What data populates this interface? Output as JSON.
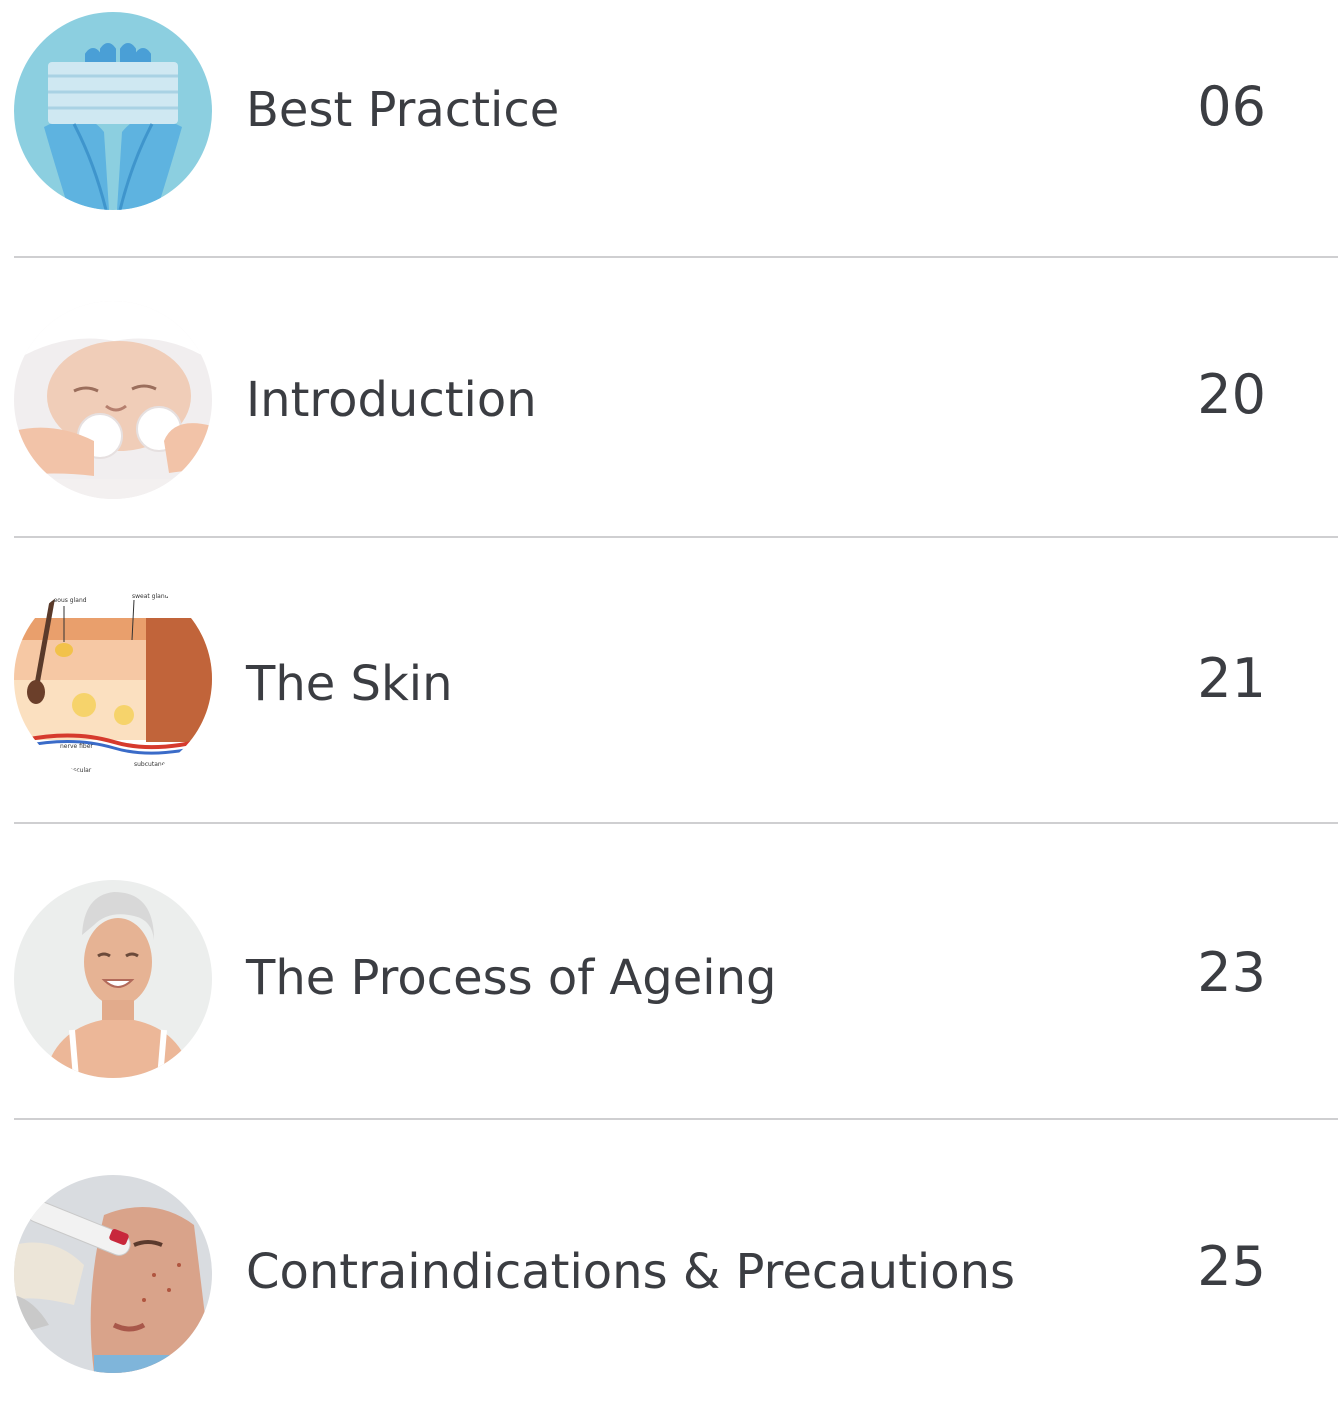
{
  "toc": {
    "entries": [
      {
        "title": "Best Practice",
        "page": "06",
        "thumbnail": "gloved-hands-holding-mask"
      },
      {
        "title": "Introduction",
        "page": "20",
        "thumbnail": "facial-cleansing-cotton-pads"
      },
      {
        "title": "The Skin",
        "page": "21",
        "thumbnail": "skin-anatomy-diagram"
      },
      {
        "title": "The Process of Ageing",
        "page": "23",
        "thumbnail": "smiling-older-woman-portrait"
      },
      {
        "title": "Contraindications & Precautions",
        "page": "25",
        "thumbnail": "microneedling-treatment-face"
      }
    ],
    "diagram_labels": [
      "sebaceous gland",
      "sweat gland",
      "nerve fiber",
      "vascular",
      "subcutaneous"
    ]
  },
  "colors": {
    "text": "#3b3d42",
    "divider": "#cfcfd1",
    "background": "#ffffff"
  }
}
